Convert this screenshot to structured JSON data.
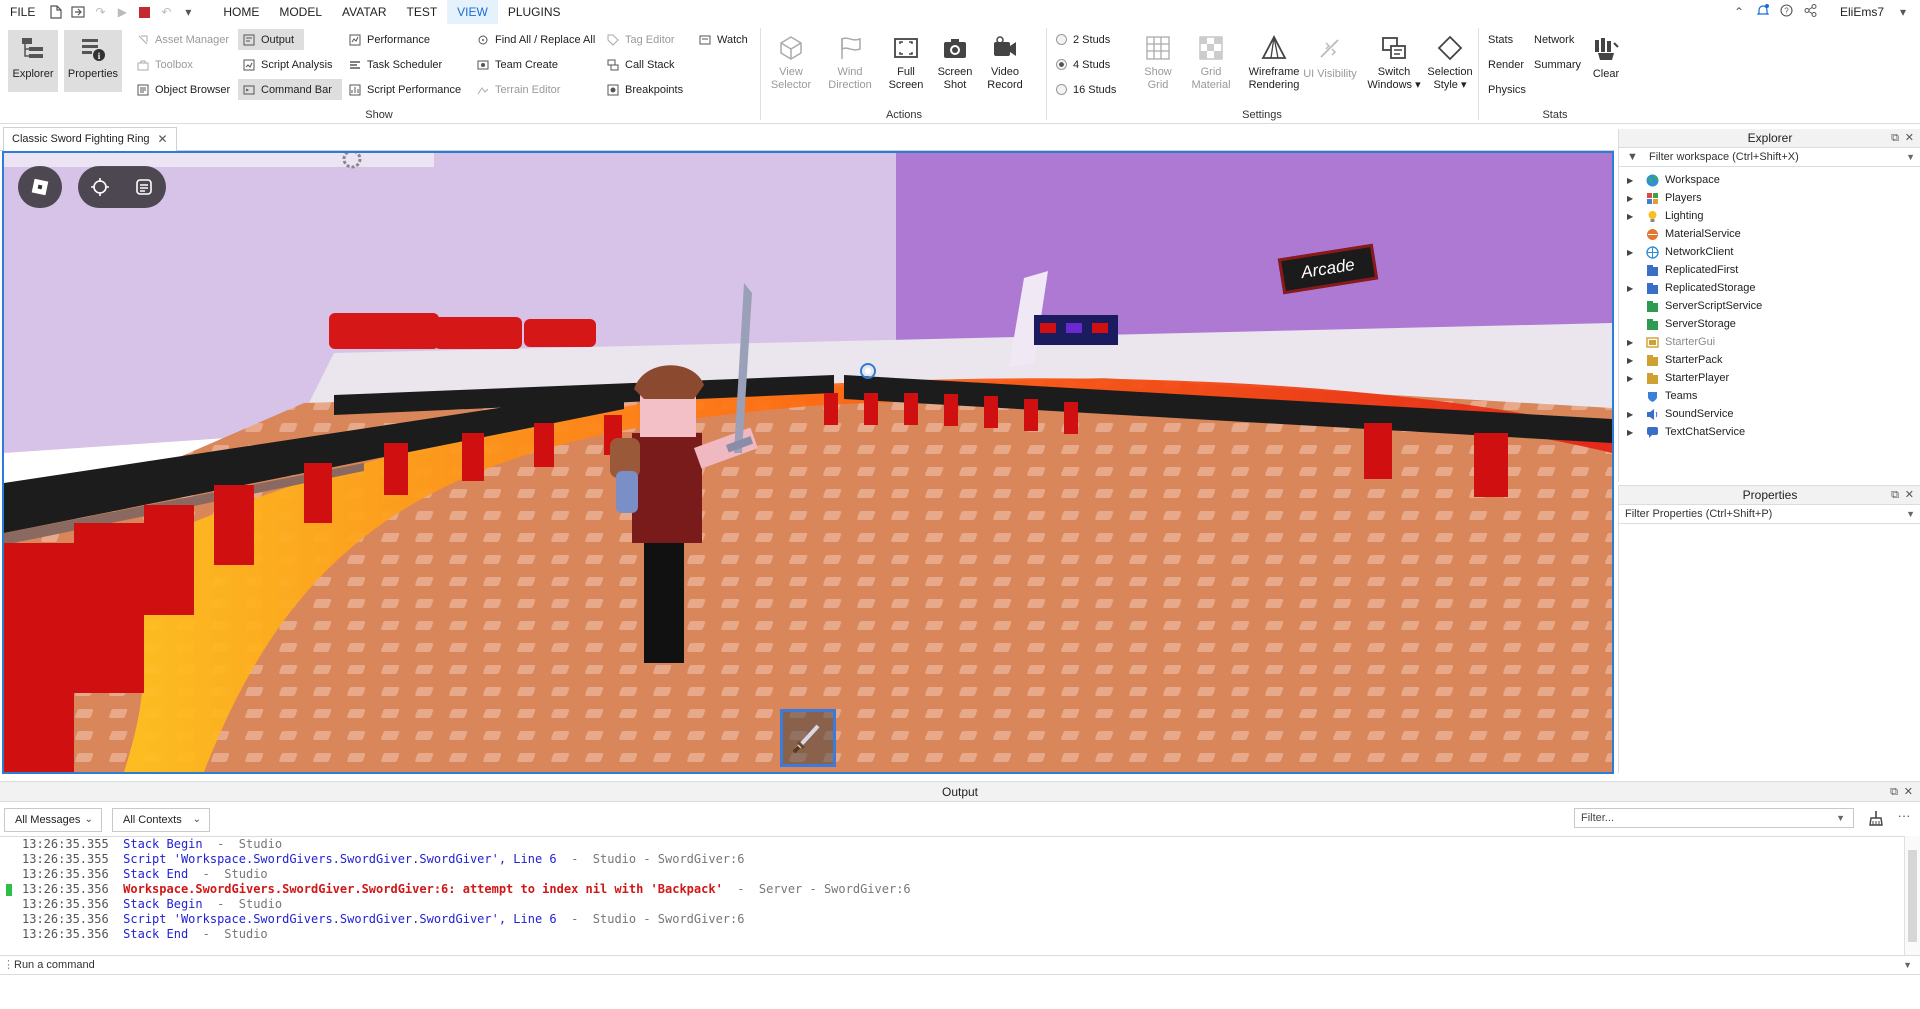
{
  "menubar": {
    "file_label": "FILE",
    "tabs": [
      {
        "label": "HOME",
        "active": false
      },
      {
        "label": "MODEL",
        "active": false
      },
      {
        "label": "AVATAR",
        "active": false
      },
      {
        "label": "TEST",
        "active": false
      },
      {
        "label": "VIEW",
        "active": true
      },
      {
        "label": "PLUGINS",
        "active": false
      }
    ],
    "username": "EliEms7",
    "accent_color": "#1a6dd4"
  },
  "ribbon": {
    "show": {
      "group_label": "Show",
      "explorer_label": "Explorer",
      "properties_label": "Properties",
      "asset_manager_label": "Asset Manager",
      "toolbox_label": "Toolbox",
      "object_browser_label": "Object Browser",
      "output_label": "Output",
      "script_analysis_label": "Script Analysis",
      "command_bar_label": "Command Bar",
      "performance_label": "Performance",
      "task_scheduler_label": "Task Scheduler",
      "script_performance_label": "Script Performance",
      "find_all_label": "Find All / Replace All",
      "team_create_label": "Team Create",
      "terrain_editor_label": "Terrain Editor",
      "tag_editor_label": "Tag Editor",
      "call_stack_label": "Call Stack",
      "breakpoints_label": "Breakpoints",
      "watch_label": "Watch"
    },
    "actions": {
      "group_label": "Actions",
      "view_selector_l1": "View",
      "view_selector_l2": "Selector",
      "wind_direction_l1": "Wind",
      "wind_direction_l2": "Direction",
      "full_screen_l1": "Full",
      "full_screen_l2": "Screen",
      "screen_shot_l1": "Screen",
      "screen_shot_l2": "Shot",
      "video_record_l1": "Video",
      "video_record_l2": "Record"
    },
    "settings": {
      "group_label": "Settings",
      "studs_2_label": "2 Studs",
      "studs_4_label": "4 Studs",
      "studs_16_label": "16 Studs",
      "selected_studs": "4 Studs",
      "show_grid_l1": "Show",
      "show_grid_l2": "Grid",
      "grid_material_l1": "Grid",
      "grid_material_l2": "Material",
      "wireframe_l1": "Wireframe",
      "wireframe_l2": "Rendering",
      "ui_visibility_label": "UI Visibility",
      "switch_windows_l1": "Switch",
      "switch_windows_l2": "Windows",
      "selection_style_l1": "Selection",
      "selection_style_l2": "Style"
    },
    "stats": {
      "group_label": "Stats",
      "stats_label": "Stats",
      "render_label": "Render",
      "physics_label": "Physics",
      "network_label": "Network",
      "summary_label": "Summary",
      "clear_label": "Clear"
    }
  },
  "document": {
    "tab_title": "Classic Sword Fighting Ring"
  },
  "viewport": {
    "sign_text": "Arcade",
    "highlight_color": "#2c7dd8"
  },
  "explorer": {
    "title": "Explorer",
    "filter_placeholder": "Filter workspace (Ctrl+Shift+X)",
    "items": [
      {
        "label": "Workspace",
        "icon": "globe-icon",
        "expandable": true,
        "dim": false
      },
      {
        "label": "Players",
        "icon": "players-icon",
        "expandable": true,
        "dim": false
      },
      {
        "label": "Lighting",
        "icon": "lightbulb-icon",
        "expandable": true,
        "dim": false
      },
      {
        "label": "MaterialService",
        "icon": "material-icon",
        "expandable": false,
        "dim": false
      },
      {
        "label": "NetworkClient",
        "icon": "network-icon",
        "expandable": true,
        "dim": false
      },
      {
        "label": "ReplicatedFirst",
        "icon": "replicated-first-icon",
        "expandable": false,
        "dim": false
      },
      {
        "label": "ReplicatedStorage",
        "icon": "replicated-storage-icon",
        "expandable": true,
        "dim": false
      },
      {
        "label": "ServerScriptService",
        "icon": "server-script-icon",
        "expandable": false,
        "dim": false
      },
      {
        "label": "ServerStorage",
        "icon": "server-storage-icon",
        "expandable": false,
        "dim": false
      },
      {
        "label": "StarterGui",
        "icon": "starter-gui-icon",
        "expandable": true,
        "dim": true
      },
      {
        "label": "StarterPack",
        "icon": "starter-pack-icon",
        "expandable": true,
        "dim": false
      },
      {
        "label": "StarterPlayer",
        "icon": "starter-player-icon",
        "expandable": true,
        "dim": false
      },
      {
        "label": "Teams",
        "icon": "teams-icon",
        "expandable": false,
        "dim": false
      },
      {
        "label": "SoundService",
        "icon": "sound-icon",
        "expandable": true,
        "dim": false
      },
      {
        "label": "TextChatService",
        "icon": "chat-icon",
        "expandable": true,
        "dim": false
      }
    ]
  },
  "properties": {
    "title": "Properties",
    "filter_placeholder": "Filter Properties (Ctrl+Shift+P)"
  },
  "output": {
    "title": "Output",
    "messages_filter": "All Messages",
    "contexts_filter": "All Contexts",
    "filter_placeholder": "Filter...",
    "lines": [
      {
        "ts": "13:26:35.355",
        "text": "Stack Begin",
        "src": "  -  Studio",
        "type": "info"
      },
      {
        "ts": "13:26:35.355",
        "text": "Script 'Workspace.SwordGivers.SwordGiver.SwordGiver', Line 6",
        "src": "  -  Studio - SwordGiver:6",
        "type": "info"
      },
      {
        "ts": "13:26:35.356",
        "text": "Stack End",
        "src": "  -  Studio",
        "type": "info"
      },
      {
        "ts": "13:26:35.356",
        "text": "Workspace.SwordGivers.SwordGiver.SwordGiver:6: attempt to index nil with 'Backpack'",
        "src": "  -  Server - SwordGiver:6",
        "type": "error"
      },
      {
        "ts": "13:26:35.356",
        "text": "Stack Begin",
        "src": "  -  Studio",
        "type": "info"
      },
      {
        "ts": "13:26:35.356",
        "text": "Script 'Workspace.SwordGivers.SwordGiver.SwordGiver', Line 6",
        "src": "  -  Studio - SwordGiver:6",
        "type": "info"
      },
      {
        "ts": "13:26:35.356",
        "text": "Stack End",
        "src": "  -  Studio",
        "type": "info"
      }
    ],
    "command_placeholder": "Run a command",
    "error_color": "#d11717",
    "info_color": "#1f1fd6"
  }
}
